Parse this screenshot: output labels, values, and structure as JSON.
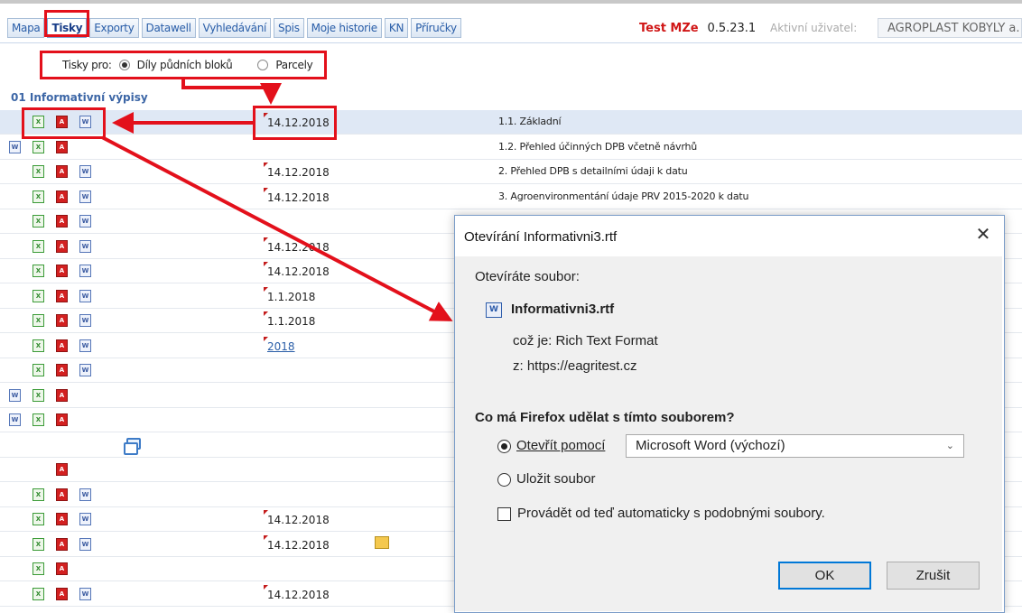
{
  "nav": {
    "tabs": [
      "Mapa",
      "Tisky",
      "Exporty",
      "Datawell",
      "Vyhledávání",
      "Spis",
      "Moje historie",
      "KN",
      "Příručky"
    ],
    "active": "Tisky"
  },
  "header": {
    "env": "Test MZe",
    "version": "0.5.23.1",
    "user_label": "Aktivní uživatel:",
    "user_value": "AGROPLAST KOBYLY a."
  },
  "print_for": {
    "label": "Tisky pro:",
    "option1": "Díly půdních bloků",
    "option2": "Parcely",
    "selected": "Díly půdních bloků"
  },
  "section": {
    "title": "01 Informativní výpisy"
  },
  "rows": [
    {
      "date": "14.12.2018",
      "text": "1.1. Základní"
    },
    {
      "date": "",
      "text": "1.2. Přehled účinných DPB včetně návrhů"
    },
    {
      "date": "14.12.2018",
      "text": "2. Přehled DPB s detailními údaji k datu"
    },
    {
      "date": "14.12.2018",
      "text": "3. Agroenvironmentání údaje PRV 2015-2020 k datu"
    },
    {
      "date": "",
      "text": ""
    },
    {
      "date": "14.12.2018",
      "text": ""
    },
    {
      "date": "14.12.2018",
      "text": ""
    },
    {
      "date": "1.1.2018",
      "text": ""
    },
    {
      "date": "1.1.2018",
      "text": ""
    },
    {
      "date": "2018",
      "text": ""
    },
    {
      "date": "",
      "text": ""
    },
    {
      "date": "",
      "text": ""
    },
    {
      "date": "",
      "text": ""
    },
    {
      "date": "",
      "text": ""
    },
    {
      "date": "",
      "text": ""
    },
    {
      "date": "",
      "text": ""
    },
    {
      "date": "14.12.2018",
      "text": ""
    },
    {
      "date": "14.12.2018",
      "text": ""
    },
    {
      "date": "",
      "text": ""
    },
    {
      "date": "14.12.2018",
      "text": ""
    }
  ],
  "dialog": {
    "title": "Otevírání Informativni3.rtf",
    "opening": "Otevíráte soubor:",
    "filename": "Informativni3.rtf",
    "which_is": "což je:  Rich Text Format",
    "from": "z:  https://eagritest.cz",
    "question": "Co má Firefox udělat s tímto souborem?",
    "open_with": "Otevřít pomocí",
    "app": "Microsoft Word (výchozí)",
    "save": "Uložit soubor",
    "auto": "Provádět od teď automaticky s podobnými soubory.",
    "ok": "OK",
    "cancel": "Zrušit"
  },
  "colors": {
    "highlight": "#e3101b",
    "link": "#2a5ea8",
    "env": "#d01616"
  }
}
